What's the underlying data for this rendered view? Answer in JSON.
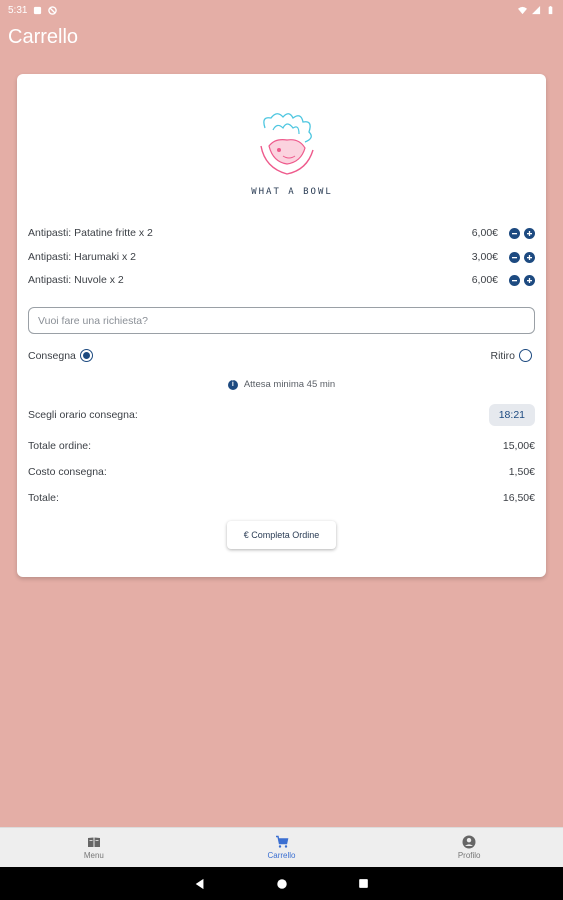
{
  "status_bar": {
    "time": "5:31"
  },
  "header": {
    "title": "Carrello"
  },
  "logo": {
    "text": "WHAT A BOWL"
  },
  "items": [
    {
      "name": "Antipasti: Patatine fritte x 2",
      "price": "6,00€"
    },
    {
      "name": "Antipasti: Harumaki x 2",
      "price": "3,00€"
    },
    {
      "name": "Antipasti: Nuvole x 2",
      "price": "6,00€"
    }
  ],
  "request": {
    "placeholder": "Vuoi fare una richiesta?"
  },
  "delivery_options": {
    "delivery_label": "Consegna",
    "pickup_label": "Ritiro",
    "selected": "Consegna"
  },
  "info": {
    "min_wait": "Attesa minima 45 min"
  },
  "details": {
    "time_label": "Scegli orario consegna:",
    "time_value": "18:21",
    "order_total_label": "Totale ordine:",
    "order_total_value": "15,00€",
    "delivery_cost_label": "Costo consegna:",
    "delivery_cost_value": "1,50€",
    "total_label": "Totale:",
    "total_value": "16,50€"
  },
  "actions": {
    "complete_label": "€ Completa Ordine"
  },
  "bottom_nav": [
    {
      "label": "Menu",
      "icon": "menu-book-icon",
      "active": false
    },
    {
      "label": "Carrello",
      "icon": "cart-icon",
      "active": true
    },
    {
      "label": "Profilo",
      "icon": "account-icon",
      "active": false
    }
  ],
  "colors": {
    "background": "#e4aea6",
    "accent": "#1d4a80",
    "active_nav": "#3b6fd1"
  }
}
